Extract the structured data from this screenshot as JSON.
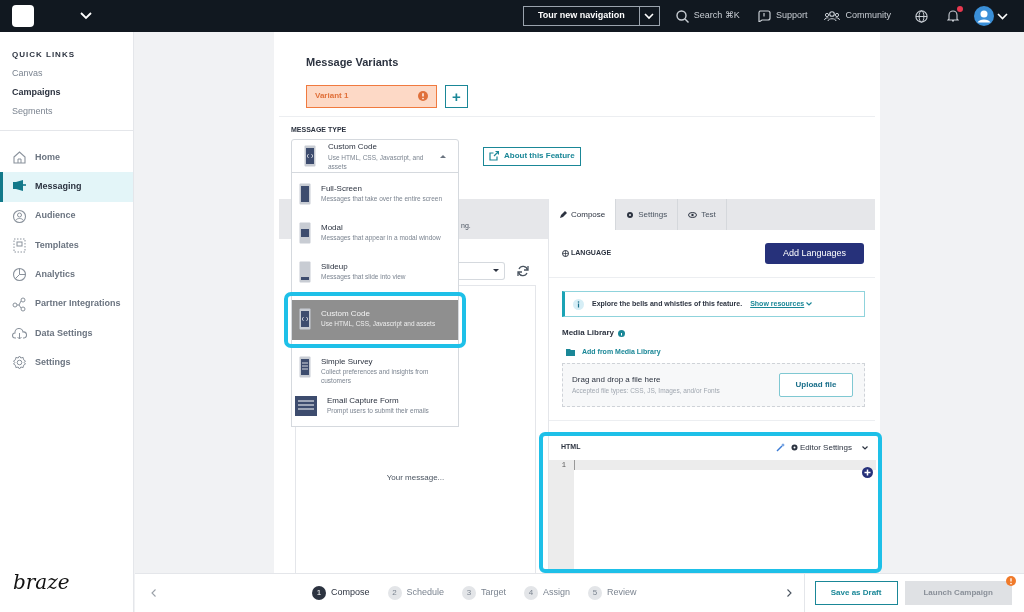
{
  "topbar": {
    "tour_button": "Tour new navigation",
    "search": "Search ⌘K",
    "links": [
      {
        "kind": "support",
        "label": "Support"
      },
      {
        "kind": "community",
        "label": "Community"
      }
    ],
    "notification_dot": true
  },
  "sidebar": {
    "quick_links_title": "QUICK LINKS",
    "quick_links": [
      {
        "label": "Canvas",
        "selected": false
      },
      {
        "label": "Campaigns",
        "selected": true
      },
      {
        "label": "Segments",
        "selected": false
      }
    ],
    "nav": [
      {
        "kind": "home",
        "label": "Home",
        "selected": false
      },
      {
        "kind": "messaging",
        "label": "Messaging",
        "selected": true
      },
      {
        "kind": "audience",
        "label": "Audience",
        "selected": false
      },
      {
        "kind": "templates",
        "label": "Templates",
        "selected": false
      },
      {
        "kind": "analytics",
        "label": "Analytics",
        "selected": false
      },
      {
        "kind": "partners",
        "label": "Partner Integrations",
        "selected": false
      },
      {
        "kind": "data",
        "label": "Data Settings",
        "selected": false
      },
      {
        "kind": "settings",
        "label": "Settings",
        "selected": false
      }
    ],
    "logo": "braze"
  },
  "variants": {
    "title": "Message Variants",
    "items": [
      {
        "label": "Variant 1",
        "selected": true,
        "warning": true
      }
    ],
    "add_button": "+"
  },
  "message_type": {
    "label": "MESSAGE TYPE",
    "value": {
      "title": "Custom Code",
      "description": "Use HTML, CSS, Javascript, and assets"
    },
    "expanded": true,
    "about_button": "About this Feature",
    "options": [
      {
        "kind": "fullscreen",
        "title": "Full-Screen",
        "description": "Messages that take over the entire screen",
        "selected": false,
        "highlighted": false
      },
      {
        "kind": "modal",
        "title": "Modal",
        "description": "Messages that appear in a modal window",
        "selected": false,
        "highlighted": false
      },
      {
        "kind": "slideup",
        "title": "Slideup",
        "description": "Messages that slide into view",
        "selected": false,
        "highlighted": false
      },
      {
        "kind": "code",
        "title": "Custom Code",
        "description": "Use HTML, CSS, Javascript and assets",
        "selected": true,
        "highlighted": true
      },
      {
        "kind": "survey",
        "title": "Simple Survey",
        "description": "Collect preferences and insights from customers",
        "selected": false,
        "highlighted": false
      },
      {
        "kind": "email",
        "title": "Email Capture Form",
        "description": "Prompt users to submit their emails",
        "selected": false,
        "highlighted": false
      }
    ]
  },
  "preview": {
    "banner_text": "ng.",
    "placeholder": "Your message..."
  },
  "compose": {
    "tabs": [
      {
        "kind": "compose",
        "label": "Compose",
        "selected": true
      },
      {
        "kind": "settings",
        "label": "Settings",
        "selected": false
      },
      {
        "kind": "test",
        "label": "Test",
        "selected": false
      }
    ],
    "language_label": "LANGUAGE",
    "add_languages_button": "Add Languages",
    "info_banner": {
      "text": "Explore the bells and whistles of this feature.",
      "link": "Show resources"
    },
    "media_library": {
      "title": "Media Library",
      "add_link": "Add from Media Library",
      "drop_title": "Drag and drop a file here",
      "drop_hint": "Accepted file types: CSS, JS, Images, and/or Fonts",
      "upload_button": "Upload file"
    },
    "editor": {
      "label": "HTML",
      "settings": "Editor Settings",
      "line_numbers": [
        "1"
      ],
      "highlighted": true
    }
  },
  "steps": [
    {
      "number": "1",
      "label": "Compose",
      "selected": true
    },
    {
      "number": "2",
      "label": "Schedule",
      "selected": false
    },
    {
      "number": "3",
      "label": "Target",
      "selected": false
    },
    {
      "number": "4",
      "label": "Assign",
      "selected": false
    },
    {
      "number": "5",
      "label": "Review",
      "selected": false
    }
  ],
  "footer_buttons": [
    {
      "label": "Save as Draft",
      "disabled": false,
      "badge": false
    },
    {
      "label": "Launch Campaign",
      "disabled": true,
      "badge": true
    }
  ]
}
